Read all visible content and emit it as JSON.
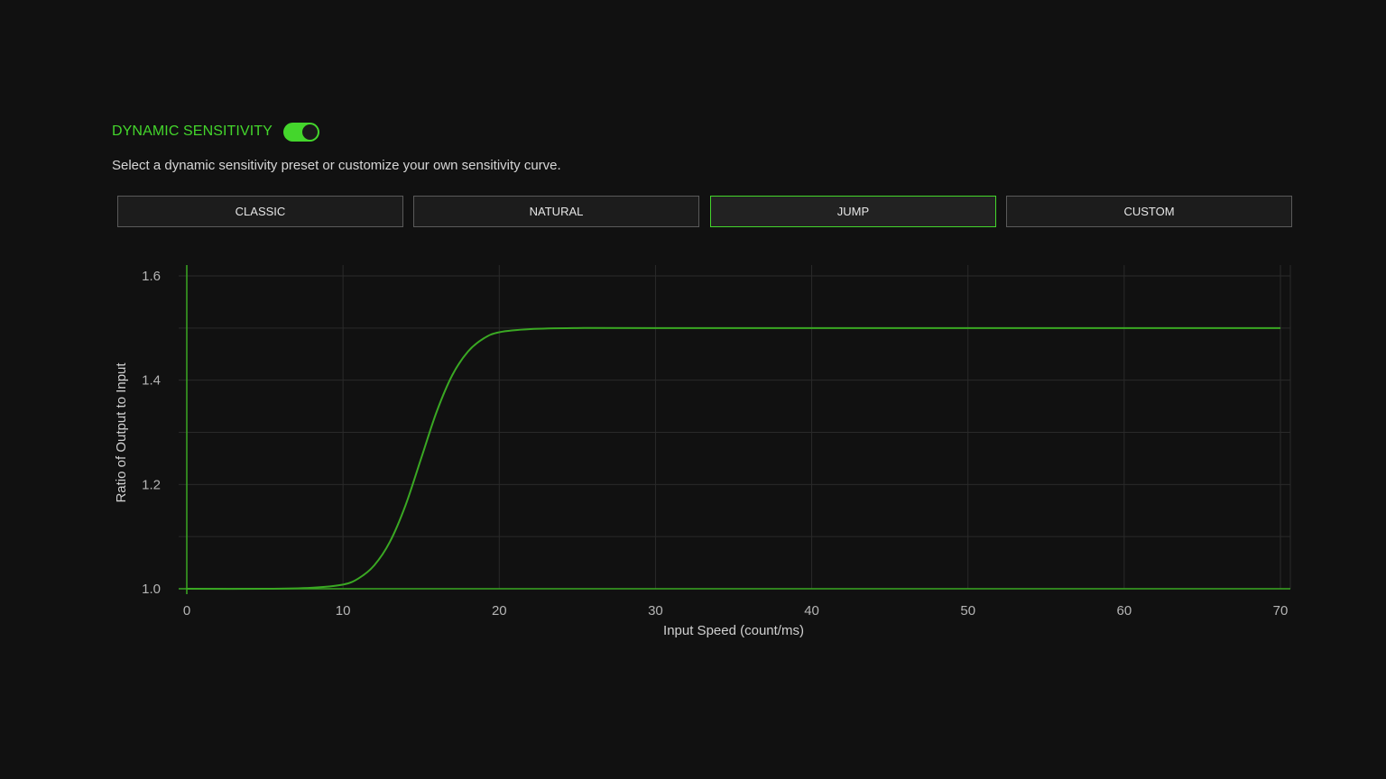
{
  "header": {
    "title": "DYNAMIC SENSITIVITY",
    "toggle_on": true,
    "subtitle": "Select a dynamic sensitivity preset or customize your own sensitivity curve."
  },
  "presets": [
    {
      "label": "CLASSIC",
      "active": false
    },
    {
      "label": "NATURAL",
      "active": false
    },
    {
      "label": "JUMP",
      "active": true
    },
    {
      "label": "CUSTOM",
      "active": false
    }
  ],
  "colors": {
    "accent": "#44d62c",
    "curve": "#3aa823",
    "grid": "#2a2a2a",
    "background": "#111111"
  },
  "chart_data": {
    "type": "line",
    "xlabel": "Input Speed (count/ms)",
    "ylabel": "Ratio of Output to Input",
    "xlim": [
      0,
      70
    ],
    "ylim": [
      1.0,
      1.6
    ],
    "x_ticks": [
      0,
      10,
      20,
      30,
      40,
      50,
      60,
      70
    ],
    "y_ticks": [
      1.0,
      1.2,
      1.4,
      1.6
    ],
    "y_tick_labels": [
      "1.0",
      "1.2",
      "1.4",
      "1.6"
    ],
    "grid": true,
    "series": [
      {
        "x": [
          0,
          5,
          8,
          10,
          11,
          12,
          13,
          14,
          15,
          16,
          17,
          18,
          19,
          20,
          22,
          25,
          30,
          40,
          50,
          60,
          70
        ],
        "y": [
          1.0,
          1.0,
          1.002,
          1.008,
          1.02,
          1.045,
          1.09,
          1.16,
          1.25,
          1.34,
          1.41,
          1.455,
          1.48,
          1.492,
          1.498,
          1.5,
          1.5,
          1.5,
          1.5,
          1.5,
          1.5
        ]
      }
    ]
  }
}
